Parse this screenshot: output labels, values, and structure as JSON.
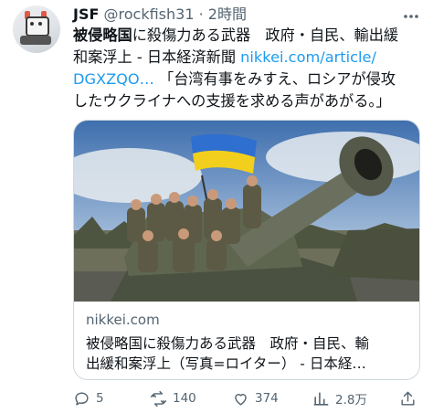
{
  "author": {
    "name": "JSF",
    "handle": "@rockfish31",
    "separator": "·",
    "time": "2時間"
  },
  "tweet": {
    "line1": "被侵略国に殺傷力ある武器　政府・自民、輸出緩",
    "line1_bold": "被侵略国",
    "line1_rest": "に殺傷力ある武器　政府・自民、輸出緩",
    "line2_text": "和案浮上 - 日本経済新聞 ",
    "line2_link": "nikkei.com/article/",
    "line3_link": "DGXZQO…",
    "line3_text": " 「台湾有事をみすえ、ロシアが侵攻",
    "line4": "したウクライナへの支援を求める声があがる。」"
  },
  "card": {
    "domain": "nikkei.com",
    "title_line1": "被侵略国に殺傷力ある武器　政府・自民、輸",
    "title_line2": "出緩和案浮上（写真=ロイター） - 日本経…",
    "flag_colors": [
      "#2f6fd0",
      "#f2cf1d"
    ]
  },
  "actions": {
    "reply_count": "5",
    "retweet_count": "140",
    "like_count": "374",
    "views_count": "2.8万"
  },
  "icons": {
    "more": "more-icon",
    "reply": "reply-icon",
    "retweet": "retweet-icon",
    "like": "like-icon",
    "views": "views-icon",
    "share": "share-icon"
  }
}
